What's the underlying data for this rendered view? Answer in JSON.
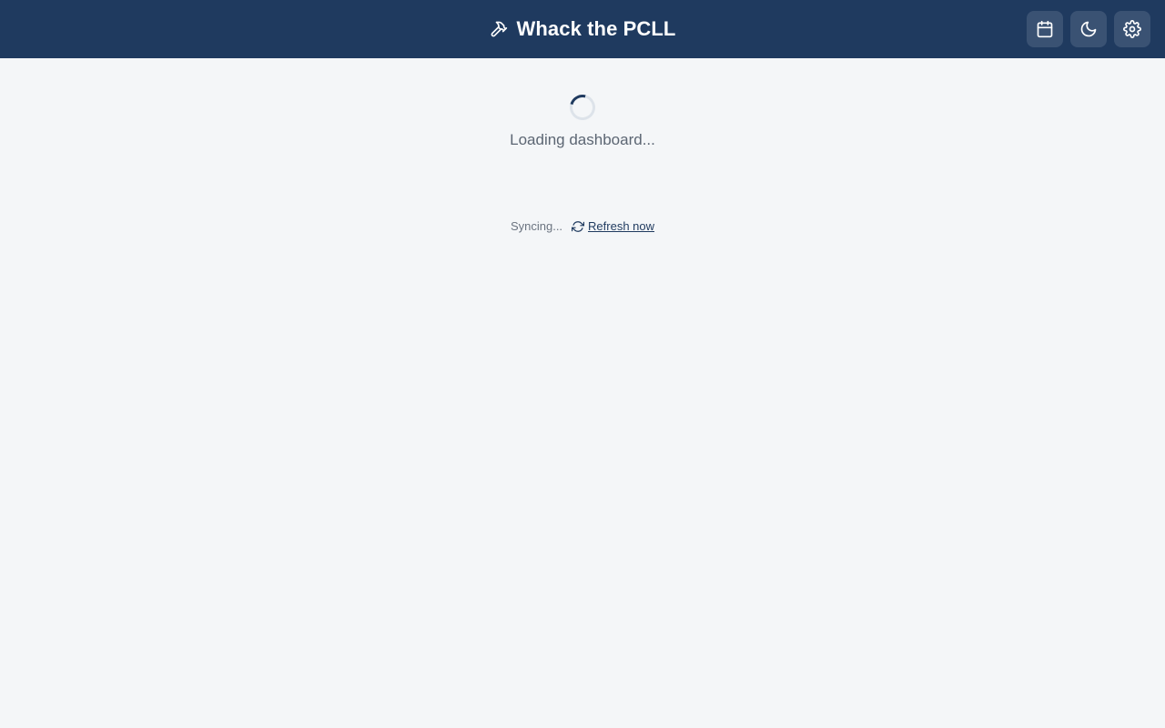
{
  "header": {
    "title": "Whack the PCLL",
    "title_icon": "hammer-icon",
    "actions": [
      {
        "name": "calendar-button",
        "icon": "calendar-icon"
      },
      {
        "name": "dark-mode-button",
        "icon": "moon-icon"
      },
      {
        "name": "settings-button",
        "icon": "gear-icon"
      }
    ]
  },
  "main": {
    "loading_text": "Loading dashboard...",
    "sync_status": "Syncing...",
    "refresh_label": "Refresh now",
    "refresh_icon": "refresh-icon"
  },
  "colors": {
    "header_bg": "#1f3a5f",
    "page_bg": "#f4f6f8",
    "button_bg": "#3a5273",
    "accent": "#1f3a5f"
  }
}
